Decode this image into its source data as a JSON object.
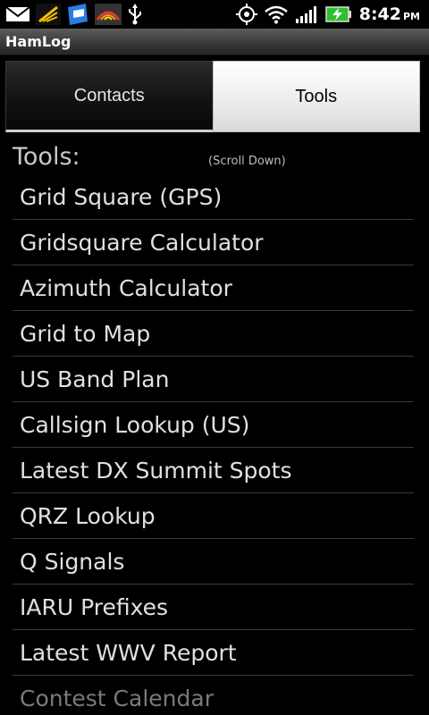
{
  "status_bar": {
    "time": "8:42",
    "ampm": "PM",
    "icons": [
      "email-icon",
      "sprint-icon",
      "flipboard-icon",
      "cnet-icon",
      "usb-icon",
      "gps-icon",
      "wifi-icon",
      "signal-icon",
      "battery-charging-icon"
    ],
    "battery_color": "#2fbf2f"
  },
  "title_bar": {
    "title": "HamLog"
  },
  "tabs": [
    {
      "label": "Contacts",
      "selected": false
    },
    {
      "label": "Tools",
      "selected": true
    }
  ],
  "section": {
    "title": "Tools:",
    "hint": "(Scroll Down)"
  },
  "tools": [
    "Grid Square (GPS)",
    "Gridsquare Calculator",
    "Azimuth Calculator",
    "Grid to Map",
    "US Band Plan",
    "Callsign Lookup (US)",
    "Latest DX Summit Spots",
    "QRZ Lookup",
    "Q Signals",
    "IARU Prefixes",
    "Latest WWV Report",
    "Contest Calendar"
  ]
}
